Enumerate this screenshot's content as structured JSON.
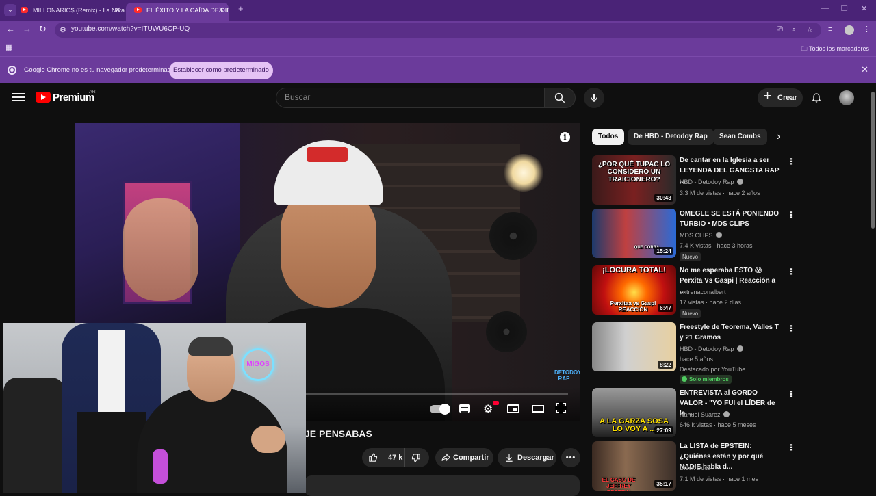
{
  "browser": {
    "tabs": [
      {
        "title": "MILLONARIO$ (Remix) - La Nota",
        "active": false
      },
      {
        "title": "EL ÉXITO Y LA CAÍDA DE DIDDY",
        "active": true
      }
    ],
    "url": "youtube.com/watch?v=ITUWU6CP-UQ",
    "bookmarks_all": "Todos los marcadores",
    "infobar_text": "Google Chrome no es tu navegador predeterminado",
    "infobar_button": "Establecer como predeterminado"
  },
  "youtube": {
    "brand": "Premium",
    "country": "AR",
    "search_placeholder": "Buscar",
    "create_label": "Crear",
    "accent": "#ff0000"
  },
  "video": {
    "title_partial": "JE PENSABAS",
    "likes": "47 k",
    "share_label": "Compartir",
    "download_label": "Descargar",
    "watermark": "DETODOY RAP",
    "pip_neon": "MIGOS"
  },
  "chips": [
    "Todos",
    "De HBD - Detodoy Rap",
    "Sean Combs"
  ],
  "recommendations": [
    {
      "title": "De cantar en la Iglesia a ser LEYENDA DEL GANGSTA RAP ...",
      "channel": "HBD - Detodoy Rap",
      "verified": true,
      "meta": "3.3 M de vistas · hace 2 años",
      "duration": "30:43",
      "thumb_text": "¿POR QUÉ TUPAC LO CONSIDERÓ UN TRAICIONERO?"
    },
    {
      "title": "OMEGLE SE ESTÁ PONIENDO TURBIO • MDS CLIPS",
      "channel": "MDS CLIPS",
      "verified": true,
      "meta": "7.4 K vistas · hace 3 horas",
      "duration": "15:24",
      "badge": "Nuevo",
      "thumb_text": "QUE CORRA"
    },
    {
      "title": "No me esperaba ESTO 😱 Perxita  Vs Gaspi | Reacción a ...",
      "channel": "entrenaconalbert",
      "verified": false,
      "meta": "17 vistas · hace 2 días",
      "duration": "6:47",
      "badge": "Nuevo",
      "thumb_text": "¡LOCURA TOTAL!",
      "thumb_sub": "Perxitaa vs Gaspi REACCIÓN"
    },
    {
      "title": "Freestyle de Teorema, Valles T y 21 Gramos",
      "channel": "HBD - Detodoy Rap",
      "verified": true,
      "meta": "hace 5 años",
      "duration": "8:22",
      "extra": "Destacado por YouTube",
      "members": "Solo miembros"
    },
    {
      "title": "ENTREVISTA al GORDO VALOR - \"YO FUI el LÍDER de la ...",
      "channel": "Nahuel Suarez",
      "verified": true,
      "meta": "646 k vistas · hace 5 meses",
      "duration": "27:09",
      "thumb_text": "A LA GARZA SOSA LO VOY A ..."
    },
    {
      "title": "La LISTA de EPSTEIN: ¿Quiénes están y por qué NADIE habla d...",
      "channel": "Dieck Docs",
      "verified": false,
      "meta": "7.1 M de vistas · hace 1 mes",
      "duration": "35:17",
      "thumb_text": "EL CASO DE JEFFREY EPSTEIN"
    }
  ]
}
